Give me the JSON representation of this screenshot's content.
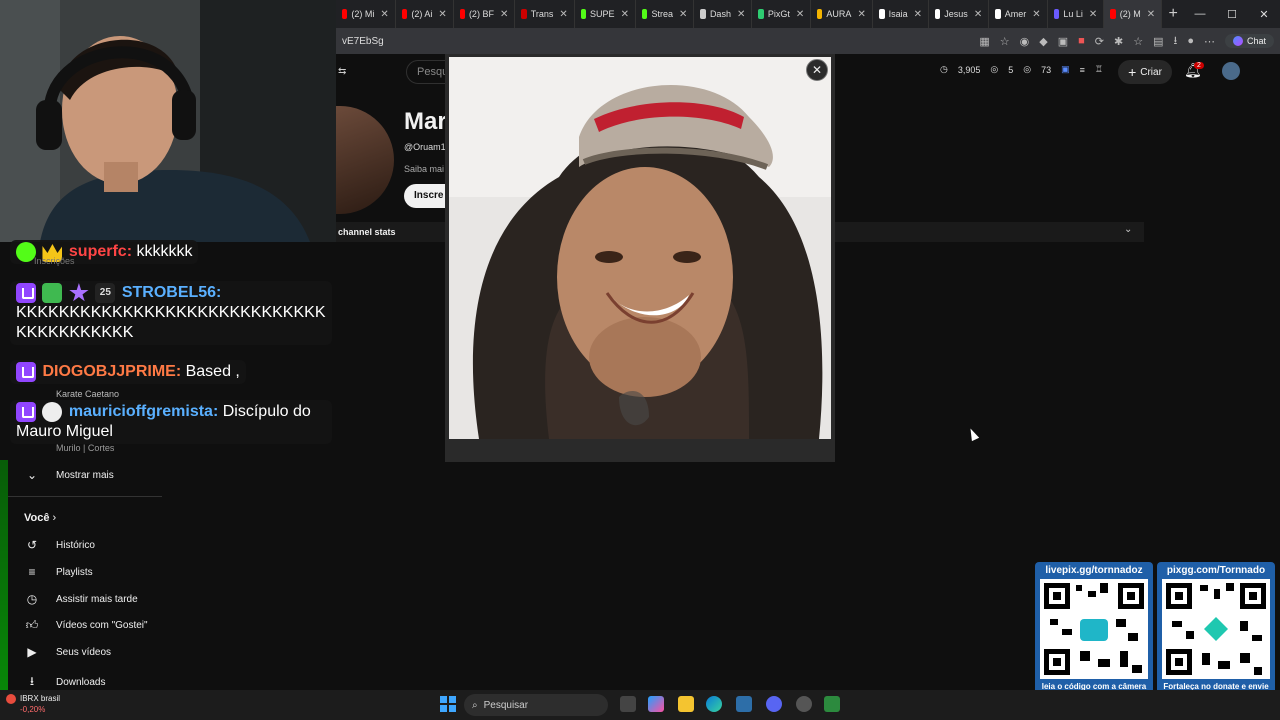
{
  "browser": {
    "tabs": [
      {
        "label": "(2) Mi",
        "color": "#ff0000"
      },
      {
        "label": "(2) Ai",
        "color": "#ff0000"
      },
      {
        "label": "(2) BF",
        "color": "#ff0000"
      },
      {
        "label": "Trans",
        "color": "#cc0000"
      },
      {
        "label": "SUPE",
        "color": "#53fc18"
      },
      {
        "label": "Strea",
        "color": "#53fc18"
      },
      {
        "label": "Dash",
        "color": "#cccccc"
      },
      {
        "label": "PixGt",
        "color": "#2ecc71"
      },
      {
        "label": "AURA",
        "color": "#f4b400"
      },
      {
        "label": "Isaia",
        "color": "#ffffff"
      },
      {
        "label": "Jesus",
        "color": "#ffffff"
      },
      {
        "label": "Amer",
        "color": "#ffffff"
      },
      {
        "label": "Lu Li",
        "color": "#6b5bff"
      },
      {
        "label": "(2) M",
        "color": "#ff0000"
      }
    ],
    "url": "vE7EbSg",
    "chat_label": "Chat"
  },
  "youtube": {
    "search_placeholder": "Pesqui",
    "stats": [
      "3,905",
      "5",
      "73"
    ],
    "create_label": "Criar",
    "bell_count": "2",
    "channel": {
      "name": "Mar",
      "handle": "@Oruam1",
      "more": "Saiba mai",
      "subscribe": "Inscre",
      "stats_bar": "channel stats"
    }
  },
  "chat": [
    {
      "user": "superfc:",
      "msg": "kkkkkkk"
    },
    {
      "user": "STROBEL56:",
      "msg": "KKKKKKKKKKKKKKKKKKKKKKKKKKKKKKKKKKKKKKKK",
      "badge_num": "25"
    },
    {
      "user": "DIOGOBJJPRIME:",
      "msg": "Based ,"
    },
    {
      "user": "mauricioffgremista:",
      "msg": "Discípulo do Mauro Miguel"
    }
  ],
  "sidebar": {
    "ghost": [
      "Inscrições",
      "Karate Caetano",
      "Murilo | Cortes"
    ],
    "show_more": "Mostrar mais",
    "you": "Você",
    "items": [
      {
        "label": "Histórico",
        "icon": "history-icon"
      },
      {
        "label": "Playlists",
        "icon": "playlist-icon"
      },
      {
        "label": "Assistir mais tarde",
        "icon": "clock-icon"
      },
      {
        "label": "Vídeos com \"Gostei\"",
        "icon": "thumbs-up-icon"
      },
      {
        "label": "Seus vídeos",
        "icon": "play-icon"
      },
      {
        "label": "Downloads",
        "icon": "download-icon"
      }
    ]
  },
  "qr": [
    {
      "title": "livepix.gg/tornnadoz",
      "foot": "leia o código com a câmera do celular."
    },
    {
      "title": "pixgg.com/Tornnado",
      "foot": "Fortaleça no donate e envie sua mensagem!"
    }
  ],
  "taskbar": {
    "search": "Pesquisar",
    "ticker_name": "IBRX brasil",
    "ticker_change": "-0,20%"
  }
}
